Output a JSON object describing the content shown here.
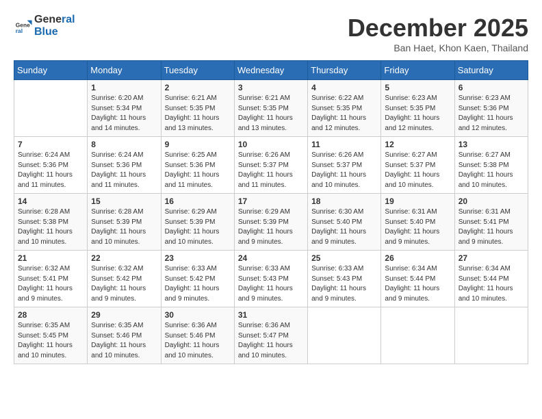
{
  "logo": {
    "line1": "General",
    "line2": "Blue"
  },
  "title": "December 2025",
  "location": "Ban Haet, Khon Kaen, Thailand",
  "days_of_week": [
    "Sunday",
    "Monday",
    "Tuesday",
    "Wednesday",
    "Thursday",
    "Friday",
    "Saturday"
  ],
  "weeks": [
    [
      {
        "num": "",
        "sunrise": "",
        "sunset": "",
        "daylight": ""
      },
      {
        "num": "1",
        "sunrise": "Sunrise: 6:20 AM",
        "sunset": "Sunset: 5:34 PM",
        "daylight": "Daylight: 11 hours and 14 minutes."
      },
      {
        "num": "2",
        "sunrise": "Sunrise: 6:21 AM",
        "sunset": "Sunset: 5:35 PM",
        "daylight": "Daylight: 11 hours and 13 minutes."
      },
      {
        "num": "3",
        "sunrise": "Sunrise: 6:21 AM",
        "sunset": "Sunset: 5:35 PM",
        "daylight": "Daylight: 11 hours and 13 minutes."
      },
      {
        "num": "4",
        "sunrise": "Sunrise: 6:22 AM",
        "sunset": "Sunset: 5:35 PM",
        "daylight": "Daylight: 11 hours and 12 minutes."
      },
      {
        "num": "5",
        "sunrise": "Sunrise: 6:23 AM",
        "sunset": "Sunset: 5:35 PM",
        "daylight": "Daylight: 11 hours and 12 minutes."
      },
      {
        "num": "6",
        "sunrise": "Sunrise: 6:23 AM",
        "sunset": "Sunset: 5:36 PM",
        "daylight": "Daylight: 11 hours and 12 minutes."
      }
    ],
    [
      {
        "num": "7",
        "sunrise": "Sunrise: 6:24 AM",
        "sunset": "Sunset: 5:36 PM",
        "daylight": "Daylight: 11 hours and 11 minutes."
      },
      {
        "num": "8",
        "sunrise": "Sunrise: 6:24 AM",
        "sunset": "Sunset: 5:36 PM",
        "daylight": "Daylight: 11 hours and 11 minutes."
      },
      {
        "num": "9",
        "sunrise": "Sunrise: 6:25 AM",
        "sunset": "Sunset: 5:36 PM",
        "daylight": "Daylight: 11 hours and 11 minutes."
      },
      {
        "num": "10",
        "sunrise": "Sunrise: 6:26 AM",
        "sunset": "Sunset: 5:37 PM",
        "daylight": "Daylight: 11 hours and 11 minutes."
      },
      {
        "num": "11",
        "sunrise": "Sunrise: 6:26 AM",
        "sunset": "Sunset: 5:37 PM",
        "daylight": "Daylight: 11 hours and 10 minutes."
      },
      {
        "num": "12",
        "sunrise": "Sunrise: 6:27 AM",
        "sunset": "Sunset: 5:37 PM",
        "daylight": "Daylight: 11 hours and 10 minutes."
      },
      {
        "num": "13",
        "sunrise": "Sunrise: 6:27 AM",
        "sunset": "Sunset: 5:38 PM",
        "daylight": "Daylight: 11 hours and 10 minutes."
      }
    ],
    [
      {
        "num": "14",
        "sunrise": "Sunrise: 6:28 AM",
        "sunset": "Sunset: 5:38 PM",
        "daylight": "Daylight: 11 hours and 10 minutes."
      },
      {
        "num": "15",
        "sunrise": "Sunrise: 6:28 AM",
        "sunset": "Sunset: 5:39 PM",
        "daylight": "Daylight: 11 hours and 10 minutes."
      },
      {
        "num": "16",
        "sunrise": "Sunrise: 6:29 AM",
        "sunset": "Sunset: 5:39 PM",
        "daylight": "Daylight: 11 hours and 10 minutes."
      },
      {
        "num": "17",
        "sunrise": "Sunrise: 6:29 AM",
        "sunset": "Sunset: 5:39 PM",
        "daylight": "Daylight: 11 hours and 9 minutes."
      },
      {
        "num": "18",
        "sunrise": "Sunrise: 6:30 AM",
        "sunset": "Sunset: 5:40 PM",
        "daylight": "Daylight: 11 hours and 9 minutes."
      },
      {
        "num": "19",
        "sunrise": "Sunrise: 6:31 AM",
        "sunset": "Sunset: 5:40 PM",
        "daylight": "Daylight: 11 hours and 9 minutes."
      },
      {
        "num": "20",
        "sunrise": "Sunrise: 6:31 AM",
        "sunset": "Sunset: 5:41 PM",
        "daylight": "Daylight: 11 hours and 9 minutes."
      }
    ],
    [
      {
        "num": "21",
        "sunrise": "Sunrise: 6:32 AM",
        "sunset": "Sunset: 5:41 PM",
        "daylight": "Daylight: 11 hours and 9 minutes."
      },
      {
        "num": "22",
        "sunrise": "Sunrise: 6:32 AM",
        "sunset": "Sunset: 5:42 PM",
        "daylight": "Daylight: 11 hours and 9 minutes."
      },
      {
        "num": "23",
        "sunrise": "Sunrise: 6:33 AM",
        "sunset": "Sunset: 5:42 PM",
        "daylight": "Daylight: 11 hours and 9 minutes."
      },
      {
        "num": "24",
        "sunrise": "Sunrise: 6:33 AM",
        "sunset": "Sunset: 5:43 PM",
        "daylight": "Daylight: 11 hours and 9 minutes."
      },
      {
        "num": "25",
        "sunrise": "Sunrise: 6:33 AM",
        "sunset": "Sunset: 5:43 PM",
        "daylight": "Daylight: 11 hours and 9 minutes."
      },
      {
        "num": "26",
        "sunrise": "Sunrise: 6:34 AM",
        "sunset": "Sunset: 5:44 PM",
        "daylight": "Daylight: 11 hours and 9 minutes."
      },
      {
        "num": "27",
        "sunrise": "Sunrise: 6:34 AM",
        "sunset": "Sunset: 5:44 PM",
        "daylight": "Daylight: 11 hours and 10 minutes."
      }
    ],
    [
      {
        "num": "28",
        "sunrise": "Sunrise: 6:35 AM",
        "sunset": "Sunset: 5:45 PM",
        "daylight": "Daylight: 11 hours and 10 minutes."
      },
      {
        "num": "29",
        "sunrise": "Sunrise: 6:35 AM",
        "sunset": "Sunset: 5:46 PM",
        "daylight": "Daylight: 11 hours and 10 minutes."
      },
      {
        "num": "30",
        "sunrise": "Sunrise: 6:36 AM",
        "sunset": "Sunset: 5:46 PM",
        "daylight": "Daylight: 11 hours and 10 minutes."
      },
      {
        "num": "31",
        "sunrise": "Sunrise: 6:36 AM",
        "sunset": "Sunset: 5:47 PM",
        "daylight": "Daylight: 11 hours and 10 minutes."
      },
      {
        "num": "",
        "sunrise": "",
        "sunset": "",
        "daylight": ""
      },
      {
        "num": "",
        "sunrise": "",
        "sunset": "",
        "daylight": ""
      },
      {
        "num": "",
        "sunrise": "",
        "sunset": "",
        "daylight": ""
      }
    ]
  ]
}
